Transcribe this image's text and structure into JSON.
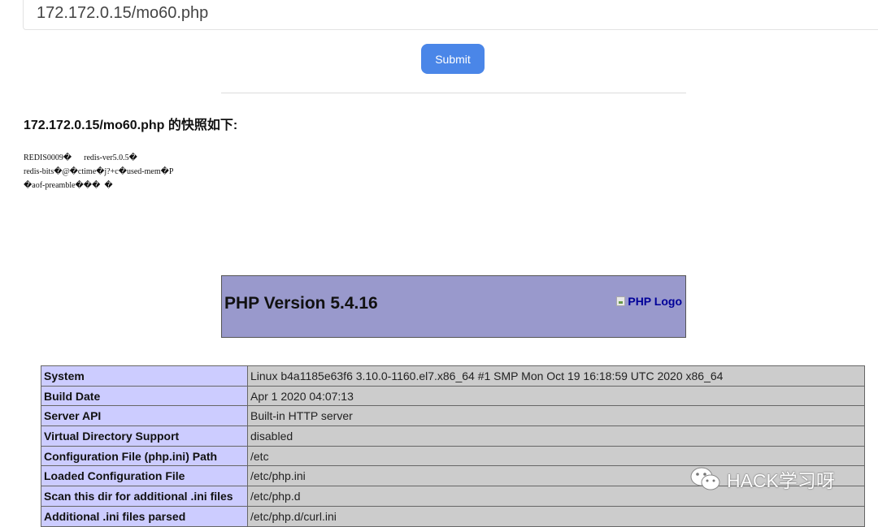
{
  "url_input": {
    "value": "172.172.0.15/mo60.php"
  },
  "submit_label": "Submit",
  "snapshot_heading": "172.172.0.15/mo60.php 的快照如下:",
  "raw_dump_lines": [
    "REDIS0009�      redis-ver5.0.5�",
    "redis-bits�@�ctime�j?+c�used-mem�P",
    "�aof-preamble���  �"
  ],
  "php_header": {
    "version_title": "PHP Version 5.4.16",
    "logo_alt": "PHP Logo",
    "colors": {
      "header_bg": "#9999cc",
      "key_bg": "#ccccff",
      "value_bg": "#cccccc",
      "logo_link": "#000099"
    }
  },
  "info_rows": [
    {
      "key": "System",
      "value": "Linux b4a1185e63f6 3.10.0-1160.el7.x86_64 #1 SMP Mon Oct 19 16:18:59 UTC 2020 x86_64"
    },
    {
      "key": "Build Date",
      "value": "Apr  1 2020 04:07:13"
    },
    {
      "key": "Server API",
      "value": "Built-in HTTP server"
    },
    {
      "key": "Virtual Directory Support",
      "value": "disabled"
    },
    {
      "key": "Configuration File (php.ini) Path",
      "value": "/etc"
    },
    {
      "key": "Loaded Configuration File",
      "value": "/etc/php.ini"
    },
    {
      "key": "Scan this dir for additional .ini files",
      "value": "/etc/php.d"
    },
    {
      "key": "Additional .ini files parsed",
      "value": "/etc/php.d/curl.ini"
    }
  ],
  "watermark": {
    "icon": "wechat-icon",
    "text": "HACK学习呀"
  },
  "accent_color": "#4a86e8"
}
